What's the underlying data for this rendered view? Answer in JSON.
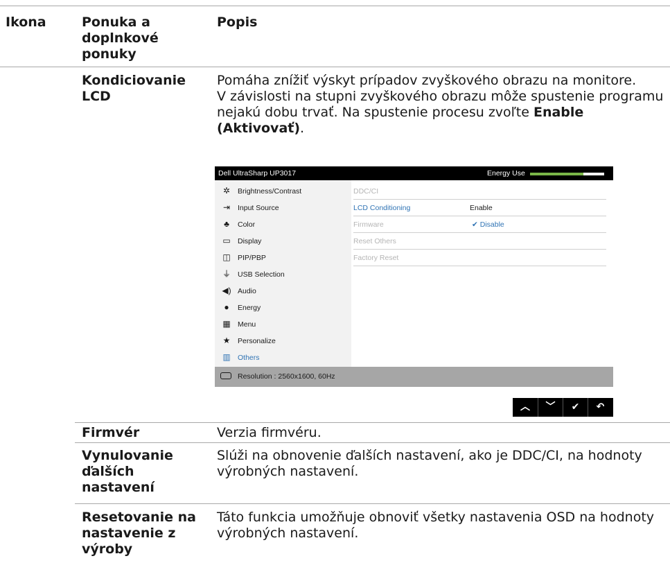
{
  "header": {
    "col1": "Ikona",
    "col2": "Ponuka a doplnkové ponuky",
    "col3": "Popis"
  },
  "rows": [
    {
      "menu": "Kondiciovanie LCD",
      "desc_p1": "Pomáha znížiť výskyt prípadov zvyškového obrazu na monitore.",
      "desc_p2": "V závislosti na stupni zvyškového obrazu môže spustenie programu nejakú dobu trvať. Na spustenie procesu zvoľte ",
      "desc_bold": "Enable (Aktivovať)",
      "desc_end": "."
    },
    {
      "menu": "Firmvér",
      "desc": "Verzia firmvéru."
    },
    {
      "menu": "Vynulovanie ďalších nastavení",
      "desc": "Slúži na obnovenie ďalších nastavení, ako je DDC/CI, na hodnoty výrobných nastavení."
    },
    {
      "menu": "Resetovanie na nastavenie z výroby",
      "desc": "Táto funkcia umožňuje obnoviť všetky nastavenia OSD na hodnoty výrobných nastavení."
    }
  ],
  "osd": {
    "title": "Dell UltraSharp UP3017",
    "energy_label": "Energy Use",
    "energy_level": 0.72,
    "accent_color": "#2f73b4",
    "energy_color": "#7ab648",
    "menu": [
      {
        "label": "Brightness/Contrast",
        "icon": "brightness-icon"
      },
      {
        "label": "Input Source",
        "icon": "input-source-icon"
      },
      {
        "label": "Color",
        "icon": "color-icon"
      },
      {
        "label": "Display",
        "icon": "display-icon"
      },
      {
        "label": "PIP/PBP",
        "icon": "pip-icon"
      },
      {
        "label": "USB Selection",
        "icon": "usb-icon"
      },
      {
        "label": "Audio",
        "icon": "speaker-icon"
      },
      {
        "label": "Energy",
        "icon": "energy-icon"
      },
      {
        "label": "Menu",
        "icon": "menu-icon"
      },
      {
        "label": "Personalize",
        "icon": "star-icon"
      },
      {
        "label": "Others",
        "icon": "others-icon"
      }
    ],
    "submenu": [
      {
        "label": "DDC/CI"
      },
      {
        "label": "LCD Conditioning",
        "option1": "Enable"
      },
      {
        "label": "Firmware",
        "option2": "Disable"
      },
      {
        "label": "Reset Others"
      },
      {
        "label": "Factory Reset"
      }
    ],
    "resolution": "Resolution : 2560x1600, 60Hz",
    "nav_buttons": [
      "up",
      "down",
      "ok",
      "back"
    ]
  }
}
